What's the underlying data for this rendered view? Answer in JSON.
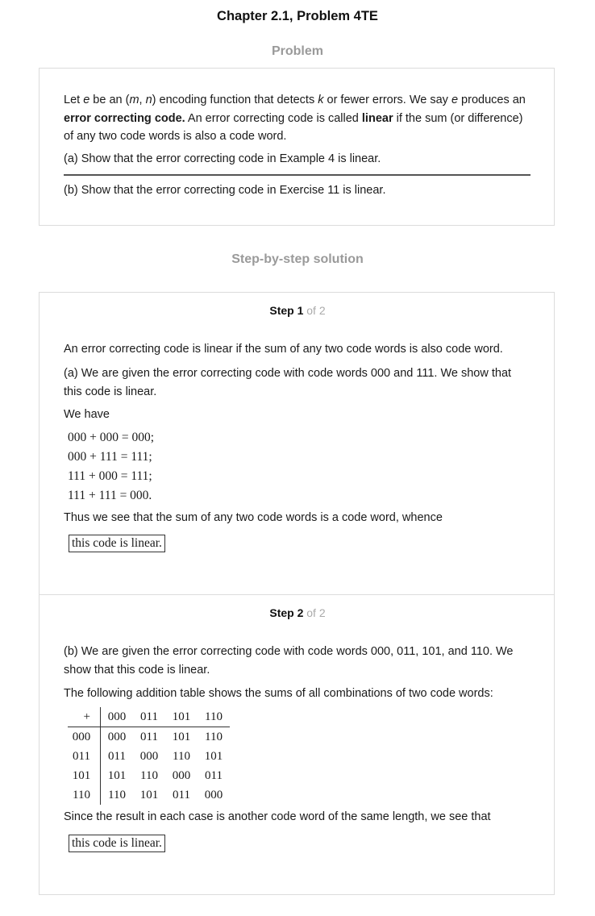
{
  "header": {
    "title": "Chapter 2.1, Problem 4TE"
  },
  "problem": {
    "section_label": "Problem",
    "para1_prefix": "Let ",
    "para1_e": "e",
    "para1_mid1": " be an (",
    "para1_m": "m",
    "para1_comma": ", ",
    "para1_n": "n",
    "para1_mid2": ") encoding function that detects ",
    "para1_k": "k",
    "para1_mid3": " or fewer errors. We say ",
    "para1_e2": "e",
    "para1_mid4": " produces an ",
    "para1_bold1": "error correcting code.",
    "para1_mid5": " An error correcting code is called ",
    "para1_bold2": "linear",
    "para1_end": " if the sum (or difference) of any two code words is also a code word.",
    "part_a": "(a) Show that the error correcting code in Example 4 is linear.",
    "part_b": "(b) Show that the error correcting code in Exercise 11 is linear."
  },
  "solution": {
    "section_label": "Step-by-step solution",
    "step1": {
      "step_word": "Step 1",
      "of_text": " of 2",
      "intro": "An error correcting code is linear if the sum of any two code words is also code word.",
      "part_a": "(a) We are given the error correcting code with code words 000 and 111. We show that this code is linear.",
      "we_have": "We have",
      "equations": [
        "000 + 000 = 000;",
        "000 + 111 = 111;",
        "111 + 000 = 111;",
        "111 + 111 = 000."
      ],
      "thus": "Thus we see that the sum of any two code words is a code word, whence",
      "conclusion": "this code is linear."
    },
    "step2": {
      "step_word": "Step 2",
      "of_text": " of 2",
      "part_b": "(b) We are given the error correcting code with code words 000, 011, 101, and 110. We show that this code is linear.",
      "table_intro": "The following addition table shows the sums of all combinations of two code words:",
      "table": {
        "corner": "+",
        "headers": [
          "000",
          "011",
          "101",
          "110"
        ],
        "rows": [
          {
            "label": "000",
            "cells": [
              "000",
              "011",
              "101",
              "110"
            ]
          },
          {
            "label": "011",
            "cells": [
              "011",
              "000",
              "110",
              "101"
            ]
          },
          {
            "label": "101",
            "cells": [
              "101",
              "110",
              "000",
              "011"
            ]
          },
          {
            "label": "110",
            "cells": [
              "110",
              "101",
              "011",
              "000"
            ]
          }
        ]
      },
      "since": "Since the result in each case is another code word of the same length, we see that",
      "conclusion": "this code is linear."
    }
  }
}
